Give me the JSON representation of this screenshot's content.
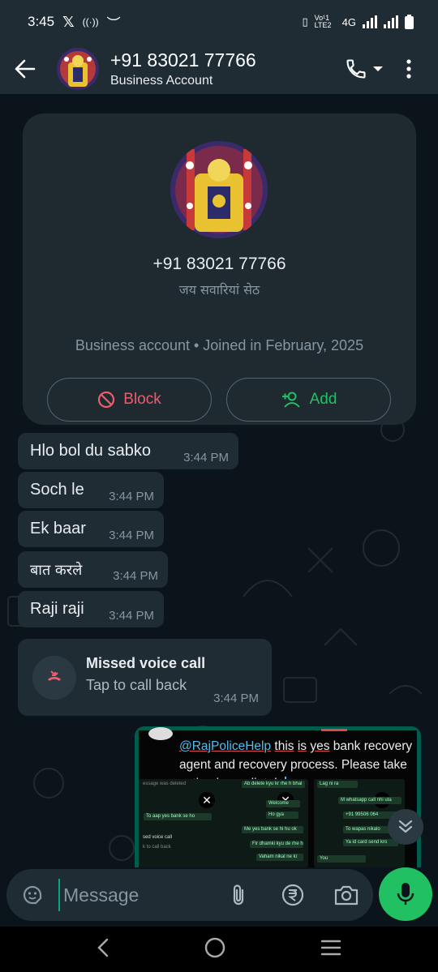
{
  "status_bar": {
    "time": "3:45",
    "network": "Vo¹1 LTE2",
    "net_type": "4G"
  },
  "header": {
    "title": "+91 83021 77766",
    "subtitle": "Business Account"
  },
  "profile_card": {
    "name": "+91 83021 77766",
    "status": "जय सवारियां सेठ",
    "meta": "Business account • Joined in February, 2025",
    "block_label": "Block",
    "add_label": "Add"
  },
  "messages": [
    {
      "text": "Hlo bol du sabko",
      "time": "3:44 PM"
    },
    {
      "text": "Soch le",
      "time": "3:44 PM"
    },
    {
      "text": "Ek baar",
      "time": "3:44 PM"
    },
    {
      "text": "बात करले",
      "time": "3:44 PM"
    },
    {
      "text": "Raji raji",
      "time": "3:44 PM"
    }
  ],
  "missed_call": {
    "title": "Missed voice call",
    "subtitle": "Tap to call back",
    "time": "3:44 PM"
  },
  "image_message": {
    "mention": "@RajPoliceHelp",
    "caption_1": "this",
    "caption_2": "is",
    "caption_3": "yes",
    "caption_4": "bank recovery agent and recovery process. Please take action immediately",
    "thumbs": [
      {
        "rows": [
          "essage was deleted",
          "To aap yes bank se ho",
          "sed voice call",
          "k to call back"
        ]
      },
      {
        "rows": [
          "Ab delete kyu kr rhe h bhai",
          "Welcome",
          "Ho gya",
          "Me yes bank se hi hu ok",
          "Fir dhamki kyu de rhe h",
          "Vaham nikal ne ki"
        ]
      },
      {
        "rows": [
          "Lag ni ra",
          "M whatsapp call nhi uta",
          "+91 99506 064",
          "To wapas nikalo",
          "Ya id card send kro",
          "You"
        ]
      }
    ]
  },
  "composer": {
    "placeholder": "Message"
  },
  "icons": {
    "back": "arrow-left-icon",
    "call": "phone-icon",
    "menu": "kebab-menu-icon",
    "block": "block-icon",
    "add": "add-contact-icon",
    "missed_call": "missed-call-icon",
    "emoji": "sticker-icon",
    "attach": "paperclip-icon",
    "payment": "rupee-icon",
    "camera": "camera-icon",
    "mic": "mic-icon",
    "scroll": "double-chevron-down-icon"
  },
  "colors": {
    "accent": "#21c063",
    "danger": "#f15c6d",
    "outgoing": "#005c4b",
    "incoming": "#202c33"
  }
}
